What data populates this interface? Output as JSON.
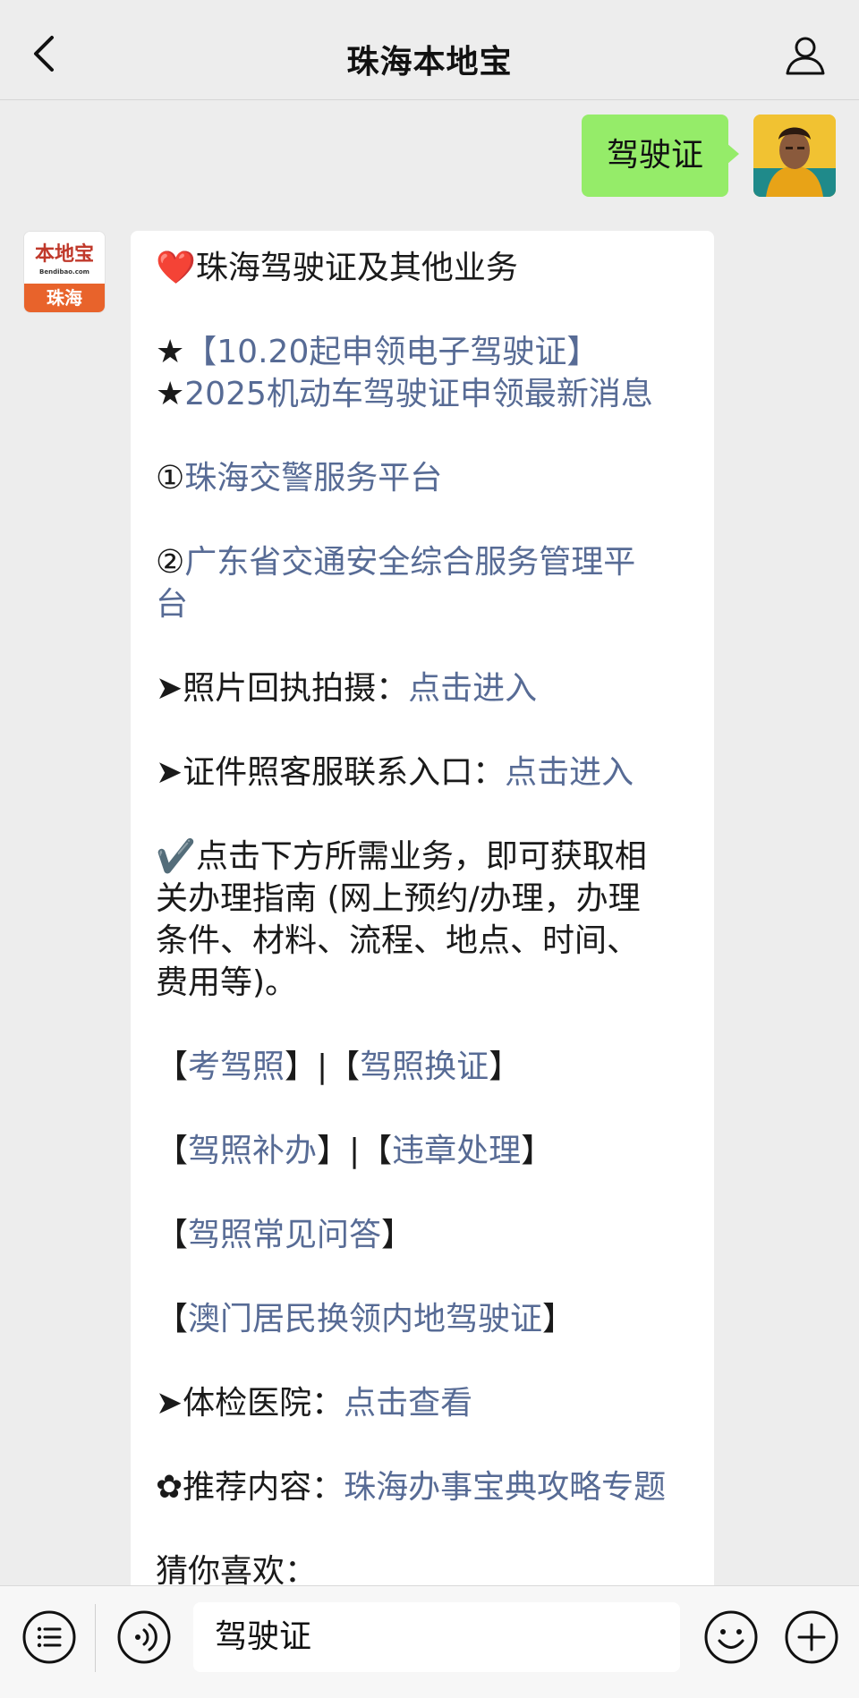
{
  "header": {
    "title": "珠海本地宝",
    "back_icon": "chevron-left-icon",
    "profile_icon": "person-icon"
  },
  "user_message": {
    "text": "驾驶证"
  },
  "bot": {
    "avatar_logo": "本地宝",
    "avatar_logo_sub": "Bendibao.com",
    "avatar_city": "珠海",
    "lines": {
      "l1": "❤️珠海驾驶证及其他业务",
      "l2_star": "★",
      "l2_link": "【10.20起申领电子驾驶证】",
      "l3_star": "★",
      "l3_link": "2025机动车驾驶证申领最新消息",
      "l4_prefix": "①",
      "l4_link": "珠海交警服务平台",
      "l5_prefix": "②",
      "l5_link_a": "广东省交通安全综合服务管理平",
      "l5_link_b": "台",
      "l6_prefix": "➤照片回执拍摄：",
      "l6_link": "点击进入",
      "l7_prefix": "➤证件照客服联系入口：",
      "l7_link": "点击进入",
      "l8_a": "✔️点击下方所需业务，即可获取相",
      "l8_b": "关办理指南 (网上预约/办理，办理",
      "l8_c": "条件、材料、流程、地点、时间、",
      "l8_d": "费用等)。",
      "l9_lb1": "【",
      "l9_link1": "考驾照",
      "l9_sep": "】|【",
      "l9_link2": "驾照换证",
      "l9_rb": "】",
      "l10_lb1": "【",
      "l10_link1": "驾照补办",
      "l10_sep": "】|【",
      "l10_link2": "违章处理",
      "l10_rb": "】",
      "l11_lb": "【",
      "l11_link": "驾照常见问答",
      "l11_rb": "】",
      "l12_lb": "【",
      "l12_link": "澳门居民换领内地驾驶证",
      "l12_rb": "】",
      "l13_prefix": "➤体检医院：",
      "l13_link": "点击查看",
      "l14_prefix": "✿推荐内容：",
      "l14_link": "珠海办事宝典攻略专题",
      "l15": "猜你喜欢："
    }
  },
  "input_bar": {
    "value": "驾驶证",
    "menu_icon": "menu-list-icon",
    "voice_icon": "voice-icon",
    "emoji_icon": "emoji-icon",
    "plus_icon": "plus-icon"
  },
  "colors": {
    "link": "#576b95",
    "user_bubble": "#95ec69",
    "background": "#ededed"
  }
}
